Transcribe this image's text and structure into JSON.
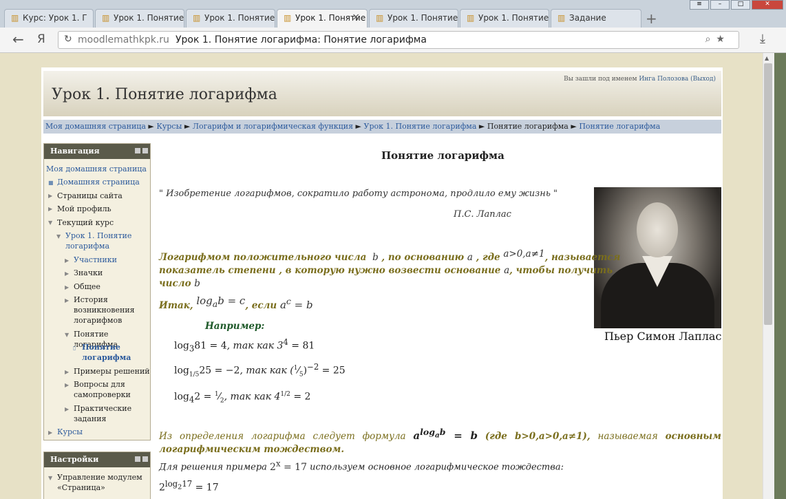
{
  "browser": {
    "tabs": [
      {
        "label": "Курс: Урок 1. Г",
        "active": false
      },
      {
        "label": "Урок 1. Понятие",
        "active": false
      },
      {
        "label": "Урок 1. Понятие",
        "active": false
      },
      {
        "label": "Урок 1. Понятие",
        "active": true
      },
      {
        "label": "Урок 1. Понятие",
        "active": false
      },
      {
        "label": "Урок 1. Понятие",
        "active": false
      },
      {
        "label": "Задание",
        "active": false
      }
    ],
    "back_icon": "←",
    "yandex_icon": "Я",
    "host": "moodlemathkpk.ru",
    "page_title": "Урок 1. Понятие логарифма: Понятие логарифма"
  },
  "header": {
    "course_title": "Урок 1. Понятие логарифма",
    "login_prefix": "Вы зашли под именем",
    "login_user": "Инга Полозова",
    "logout": "(Выход)"
  },
  "breadcrumb": {
    "items": [
      "Моя домашняя страница",
      "Курсы",
      "Логарифм и логарифмическая функция",
      "Урок 1. Понятие логарифма",
      "Понятие логарифма",
      "Понятие логарифма"
    ],
    "separator": "►"
  },
  "nav": {
    "title": "Навигация",
    "home": "Моя домашняя страница",
    "items": [
      "Домашняя страница",
      "Страницы сайта",
      "Мой профиль",
      "Текущий курс",
      "Урок 1. Понятие",
      "логарифма",
      "Участники",
      "Значки",
      "Общее",
      "История",
      "возникновения",
      "логарифмов",
      "Понятие логарифма",
      "Понятие",
      "логарифма",
      "Примеры решений",
      "Вопросы для",
      "самопроверки",
      "Практические",
      "задания",
      "Курсы"
    ]
  },
  "settings": {
    "title": "Настройки",
    "items": [
      "Управление модулем",
      "«Страница»"
    ]
  },
  "content": {
    "title": "Понятие логарифма",
    "quote": "\" Изобретение логарифмов, сократило работу астронома, продлило ему жизнь \"",
    "author": "П.С. Лаплас",
    "def_part1": "Логарифмом положительного числа",
    "def_b": "b",
    "def_part2": ", по основанию",
    "def_a": "a",
    "def_part3": ", где",
    "def_cond": "a>0,a≠1",
    "def_part4": ", называется",
    "def_line2a": "показатель степени , в которую нужно возвести основание",
    "def_line2b": ", чтобы получить",
    "def_line3": "число",
    "itak": "Итак,",
    "itak_formula": "log",
    "itak_rest": "b = c",
    "if_word": ", если",
    "if_formula": "a",
    "if_rest": " = b",
    "example_title": "Например:",
    "ex1": "log",
    "ex1b": "81 = 4",
    "ex1c": ", так как 3",
    "ex1d": " = 81",
    "ex2": "log",
    "ex2b": "25 = −2",
    "ex2c": ", так как (",
    "ex2d": ")",
    "ex2e": " = 25",
    "ex3": "log",
    "ex3b": "2 = ",
    "ex3c": ", так как 4",
    "ex3d": " = 2",
    "identity_text": "Из определения логарифма следует формула",
    "identity_cond": "(где b>0,a>0,a≠1),",
    "identity_called": "называемая",
    "identity_name": "основным",
    "identity_name2": "логарифмическим тождеством.",
    "solve_text": "Для решения примера",
    "solve_eq": "2",
    "solve_eq2": " = 17",
    "solve_rest": "используем  основное логарифмическое тождества:",
    "final_eq": "2",
    "final_eq2": " = 17"
  },
  "portrait_caption": "Пьер Симон Лаплас",
  "colors": {
    "olive": "#7a6e1d",
    "green": "#1f5a2a",
    "link": "#2c5a9c"
  }
}
